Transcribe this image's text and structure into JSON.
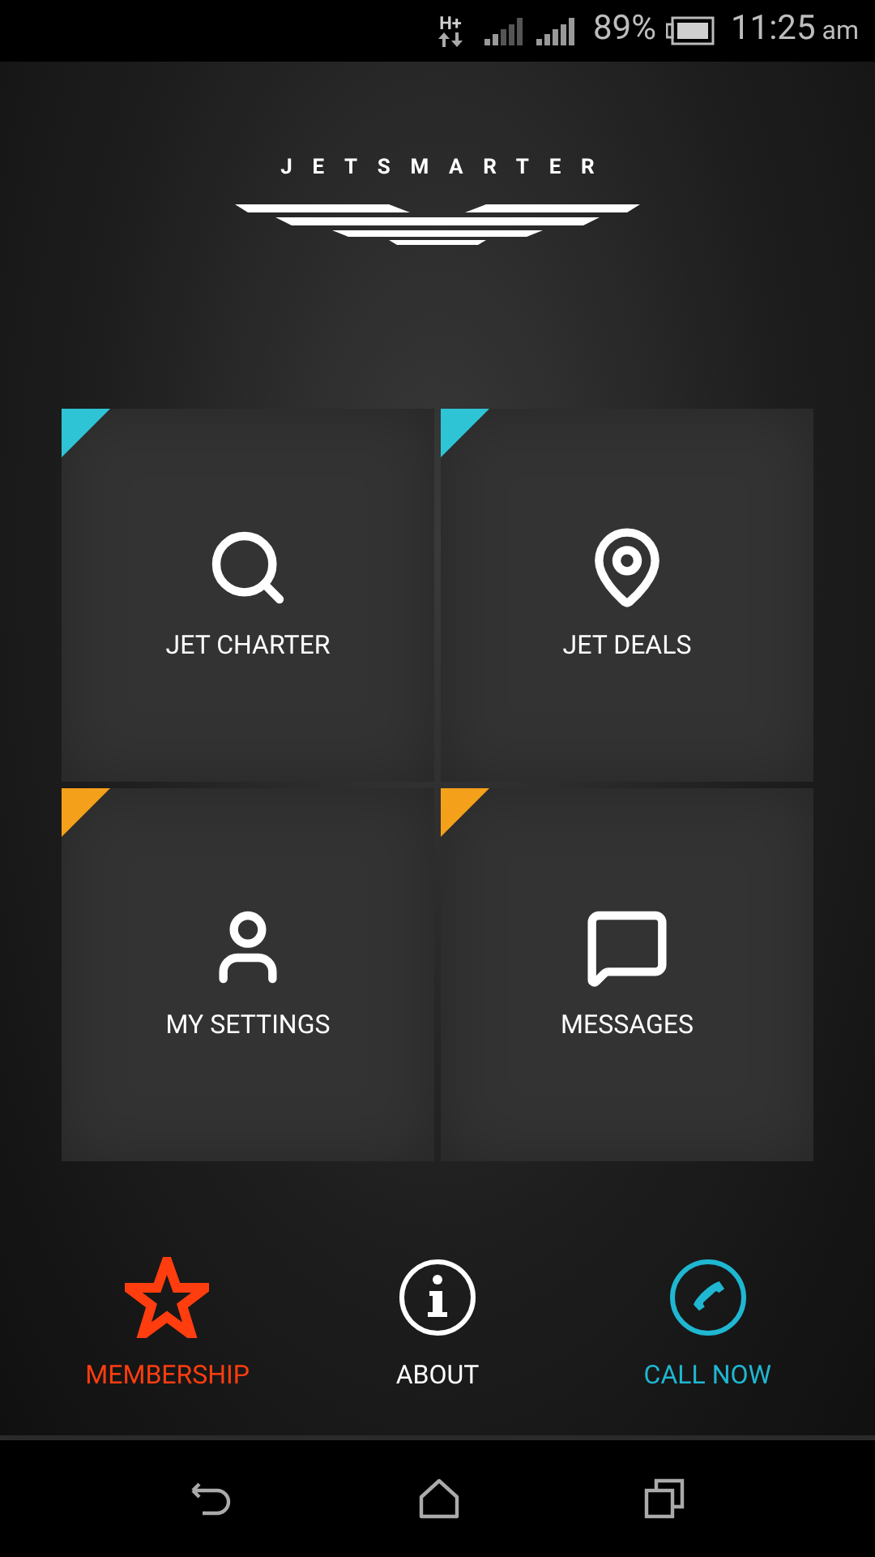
{
  "status_bar": {
    "network": "H+",
    "battery": "89%",
    "time": "11:25",
    "meridiem": "am"
  },
  "logo": {
    "wordmark": "JETSMARTER"
  },
  "tiles": [
    {
      "kind": "search",
      "label": "JET CHARTER",
      "color": "#2ec4d6"
    },
    {
      "kind": "pin",
      "label": "JET DEALS",
      "color": "#2ec4d6"
    },
    {
      "kind": "user",
      "label": "MY SETTINGS",
      "color": "#f5a01a"
    },
    {
      "kind": "chat",
      "label": "MESSAGES",
      "color": "#f5a01a"
    }
  ],
  "actions": [
    {
      "kind": "star",
      "label": "MEMBERSHIP",
      "color": "#ff3d0f"
    },
    {
      "kind": "info",
      "label": "ABOUT",
      "color": "#ffffff"
    },
    {
      "kind": "phone",
      "label": "CALL NOW",
      "color": "#1fb7d2"
    }
  ]
}
